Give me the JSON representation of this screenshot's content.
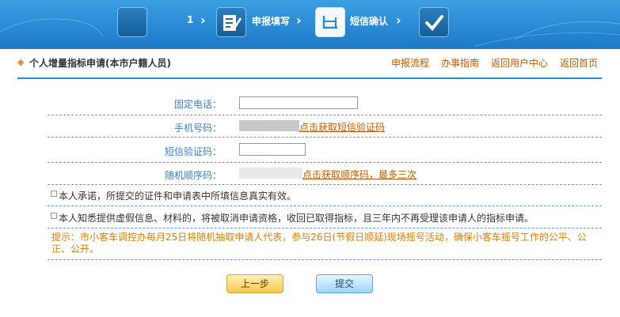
{
  "banner": {
    "steps": [
      {
        "label": "1"
      },
      {
        "label": "申报填写"
      },
      {
        "label": "短信确认"
      }
    ]
  },
  "header": {
    "title": "个人增量指标申请(本市户籍人员)",
    "nav": [
      "申报流程",
      "办事指南",
      "返回用户中心",
      "返回首页"
    ]
  },
  "form": {
    "phone_label": "固定电话：",
    "mobile_label": "手机号码：",
    "mobile_link": "点击获取短信验证码",
    "sms_label": "短信验证码：",
    "random_label": "随机顺序码：",
    "random_link": "点击获取顺序码，最多三次",
    "pledge1": "本人承诺，所提交的证件和申请表中所填信息真实有效。",
    "pledge2": "本人知悉提供虚假信息、材料的，将被取消申请资格，收回已取得指标，且三年内不再受理该申请人的指标申请。",
    "tip": "提示：市小客车调控办每月25日将随机抽取申请人代表，参与26日(节假日顺延)现场摇号活动，确保小客车摇号工作的公平、公正、公开。"
  },
  "buttons": {
    "prev": "上一步",
    "submit": "提交"
  }
}
